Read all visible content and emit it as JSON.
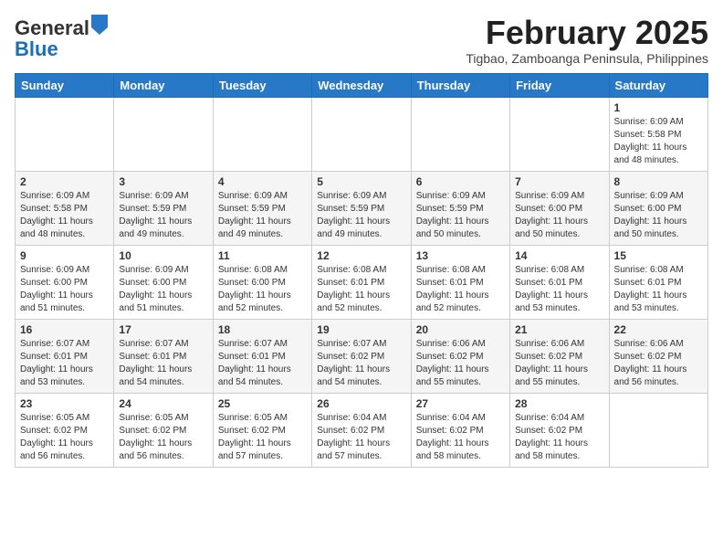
{
  "header": {
    "logo_general": "General",
    "logo_blue": "Blue",
    "month_title": "February 2025",
    "location": "Tigbao, Zamboanga Peninsula, Philippines"
  },
  "weekdays": [
    "Sunday",
    "Monday",
    "Tuesday",
    "Wednesday",
    "Thursday",
    "Friday",
    "Saturday"
  ],
  "weeks": [
    [
      {
        "day": "",
        "info": ""
      },
      {
        "day": "",
        "info": ""
      },
      {
        "day": "",
        "info": ""
      },
      {
        "day": "",
        "info": ""
      },
      {
        "day": "",
        "info": ""
      },
      {
        "day": "",
        "info": ""
      },
      {
        "day": "1",
        "info": "Sunrise: 6:09 AM\nSunset: 5:58 PM\nDaylight: 11 hours and 48 minutes."
      }
    ],
    [
      {
        "day": "2",
        "info": "Sunrise: 6:09 AM\nSunset: 5:58 PM\nDaylight: 11 hours and 48 minutes."
      },
      {
        "day": "3",
        "info": "Sunrise: 6:09 AM\nSunset: 5:59 PM\nDaylight: 11 hours and 49 minutes."
      },
      {
        "day": "4",
        "info": "Sunrise: 6:09 AM\nSunset: 5:59 PM\nDaylight: 11 hours and 49 minutes."
      },
      {
        "day": "5",
        "info": "Sunrise: 6:09 AM\nSunset: 5:59 PM\nDaylight: 11 hours and 49 minutes."
      },
      {
        "day": "6",
        "info": "Sunrise: 6:09 AM\nSunset: 5:59 PM\nDaylight: 11 hours and 50 minutes."
      },
      {
        "day": "7",
        "info": "Sunrise: 6:09 AM\nSunset: 6:00 PM\nDaylight: 11 hours and 50 minutes."
      },
      {
        "day": "8",
        "info": "Sunrise: 6:09 AM\nSunset: 6:00 PM\nDaylight: 11 hours and 50 minutes."
      }
    ],
    [
      {
        "day": "9",
        "info": "Sunrise: 6:09 AM\nSunset: 6:00 PM\nDaylight: 11 hours and 51 minutes."
      },
      {
        "day": "10",
        "info": "Sunrise: 6:09 AM\nSunset: 6:00 PM\nDaylight: 11 hours and 51 minutes."
      },
      {
        "day": "11",
        "info": "Sunrise: 6:08 AM\nSunset: 6:00 PM\nDaylight: 11 hours and 52 minutes."
      },
      {
        "day": "12",
        "info": "Sunrise: 6:08 AM\nSunset: 6:01 PM\nDaylight: 11 hours and 52 minutes."
      },
      {
        "day": "13",
        "info": "Sunrise: 6:08 AM\nSunset: 6:01 PM\nDaylight: 11 hours and 52 minutes."
      },
      {
        "day": "14",
        "info": "Sunrise: 6:08 AM\nSunset: 6:01 PM\nDaylight: 11 hours and 53 minutes."
      },
      {
        "day": "15",
        "info": "Sunrise: 6:08 AM\nSunset: 6:01 PM\nDaylight: 11 hours and 53 minutes."
      }
    ],
    [
      {
        "day": "16",
        "info": "Sunrise: 6:07 AM\nSunset: 6:01 PM\nDaylight: 11 hours and 53 minutes."
      },
      {
        "day": "17",
        "info": "Sunrise: 6:07 AM\nSunset: 6:01 PM\nDaylight: 11 hours and 54 minutes."
      },
      {
        "day": "18",
        "info": "Sunrise: 6:07 AM\nSunset: 6:01 PM\nDaylight: 11 hours and 54 minutes."
      },
      {
        "day": "19",
        "info": "Sunrise: 6:07 AM\nSunset: 6:02 PM\nDaylight: 11 hours and 54 minutes."
      },
      {
        "day": "20",
        "info": "Sunrise: 6:06 AM\nSunset: 6:02 PM\nDaylight: 11 hours and 55 minutes."
      },
      {
        "day": "21",
        "info": "Sunrise: 6:06 AM\nSunset: 6:02 PM\nDaylight: 11 hours and 55 minutes."
      },
      {
        "day": "22",
        "info": "Sunrise: 6:06 AM\nSunset: 6:02 PM\nDaylight: 11 hours and 56 minutes."
      }
    ],
    [
      {
        "day": "23",
        "info": "Sunrise: 6:05 AM\nSunset: 6:02 PM\nDaylight: 11 hours and 56 minutes."
      },
      {
        "day": "24",
        "info": "Sunrise: 6:05 AM\nSunset: 6:02 PM\nDaylight: 11 hours and 56 minutes."
      },
      {
        "day": "25",
        "info": "Sunrise: 6:05 AM\nSunset: 6:02 PM\nDaylight: 11 hours and 57 minutes."
      },
      {
        "day": "26",
        "info": "Sunrise: 6:04 AM\nSunset: 6:02 PM\nDaylight: 11 hours and 57 minutes."
      },
      {
        "day": "27",
        "info": "Sunrise: 6:04 AM\nSunset: 6:02 PM\nDaylight: 11 hours and 58 minutes."
      },
      {
        "day": "28",
        "info": "Sunrise: 6:04 AM\nSunset: 6:02 PM\nDaylight: 11 hours and 58 minutes."
      },
      {
        "day": "",
        "info": ""
      }
    ]
  ]
}
